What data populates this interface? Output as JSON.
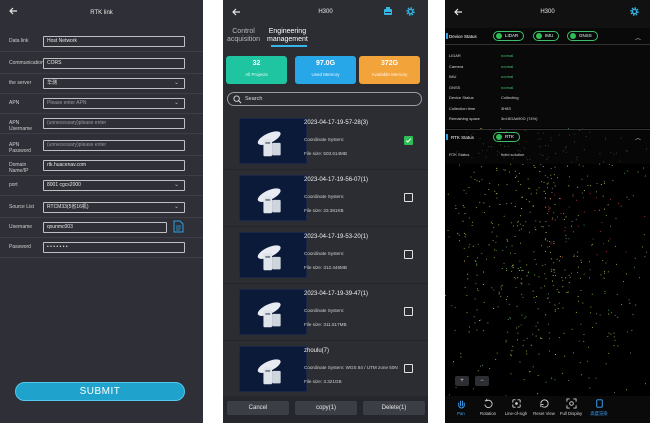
{
  "rtk_link": {
    "title": "RTK link",
    "fields": [
      {
        "label": "Data link",
        "value": "Host Network",
        "placeholder": "",
        "dropdown": false
      },
      {
        "label": "Communication",
        "value": "CORS",
        "placeholder": "",
        "dropdown": false
      },
      {
        "label": "the server",
        "value": "华测",
        "placeholder": "",
        "dropdown": true
      },
      {
        "label": "APN",
        "value": "",
        "placeholder": "Please enter APN",
        "dropdown": true
      },
      {
        "label": "APN Username",
        "value": "",
        "placeholder": "(unnecessary)please enter",
        "dropdown": false
      },
      {
        "label": "APN Password",
        "value": "",
        "placeholder": "(unnecessary)please enter",
        "dropdown": false
      },
      {
        "label": "Domain Name/IP",
        "value": "rtk.huacenav.com",
        "placeholder": "",
        "dropdown": false
      },
      {
        "label": "port",
        "value": "8001 cgcs2000",
        "placeholder": "",
        "dropdown": true
      },
      {
        "label": "Source List",
        "value": "RTCM33(5省16机)",
        "placeholder": "",
        "dropdown": true
      },
      {
        "label": "Username",
        "value": "qxunmc003",
        "placeholder": "",
        "dropdown": false
      },
      {
        "label": "Password",
        "value": "• • • • • • •",
        "placeholder": "",
        "dropdown": false
      }
    ],
    "submit_label": "SUBMIT",
    "doc_icon": "document-icon",
    "back_icon": "arrow-left-icon"
  },
  "projects": {
    "title": "H300",
    "tabs": [
      {
        "label_line1": "Control",
        "label_line2": "acquisition",
        "active": false
      },
      {
        "label_line1": "Engineering",
        "label_line2": "management",
        "active": true
      }
    ],
    "stats": [
      {
        "value": "32",
        "label": "All Projects",
        "color": "#1fc4a0"
      },
      {
        "value": "97.0G",
        "label": "Used Memory",
        "color": "#28a7e8"
      },
      {
        "value": "372G",
        "label": "Available Memory",
        "color": "#f2a33a"
      }
    ],
    "search_placeholder": "Search",
    "items": [
      {
        "name": "2023-04-17-19-57-28(3)",
        "coord_label": "Coordinate System:",
        "coord": "",
        "size_label": "File size:",
        "size": "503.614MB",
        "checked": true
      },
      {
        "name": "2023-04-17-19-56-07(1)",
        "coord_label": "Coordinate System:",
        "coord": "",
        "size_label": "File size:",
        "size": "33.381KB",
        "checked": false
      },
      {
        "name": "2023-04-17-19-53-20(1)",
        "coord_label": "Coordinate System:",
        "coord": "",
        "size_label": "File size:",
        "size": "312.446MB",
        "checked": false
      },
      {
        "name": "2023-04-17-19-39-47(1)",
        "coord_label": "Coordinate System:",
        "coord": "",
        "size_label": "File size:",
        "size": "311.517MB",
        "checked": false
      },
      {
        "name": "zhoulu(7)",
        "coord_label": "Coordinate System:",
        "coord": "WGS 84 / UTM zone 50N",
        "size_label": "File size:",
        "size": "3.321GB",
        "checked": false
      }
    ],
    "buttons": {
      "cancel": "Cancel",
      "copy": "copy(1)",
      "delete": "Delete(1)"
    }
  },
  "scan": {
    "title": "H300",
    "device_status_label": "Device Status",
    "status_pills": [
      "LIDAR",
      "IMU",
      "GNSS"
    ],
    "status_rows": [
      {
        "key": "LIDAR",
        "value": "normal",
        "green": true
      },
      {
        "key": "Camera",
        "value": "normal",
        "green": true
      },
      {
        "key": "IMU",
        "value": "normal",
        "green": true
      },
      {
        "key": "GNSS",
        "value": "normal",
        "green": true
      },
      {
        "key": "Device Status",
        "value": "Collecting",
        "green": false
      },
      {
        "key": "Collection time",
        "value": "3H8S",
        "green": false
      },
      {
        "key": "Remaining space",
        "value": "3rd:8GA#90G (74%)",
        "green": false
      }
    ],
    "rtk_status_label": "RTK Status",
    "rtk_pill": "RTK",
    "rtk_rows": [
      {
        "key": "RTK Status",
        "value": "fixed solution"
      },
      {
        "key": "",
        "value": ""
      },
      {
        "key": "",
        "value": ""
      }
    ],
    "zoom_in": "+",
    "zoom_out": "−",
    "tools": [
      "Pan",
      "Rotation",
      "Line-of-sigh",
      "Reset View",
      "Full Display",
      "高度渲染"
    ],
    "colors": {
      "accent": "#3fa6ff",
      "green": "#2fbd56"
    }
  }
}
